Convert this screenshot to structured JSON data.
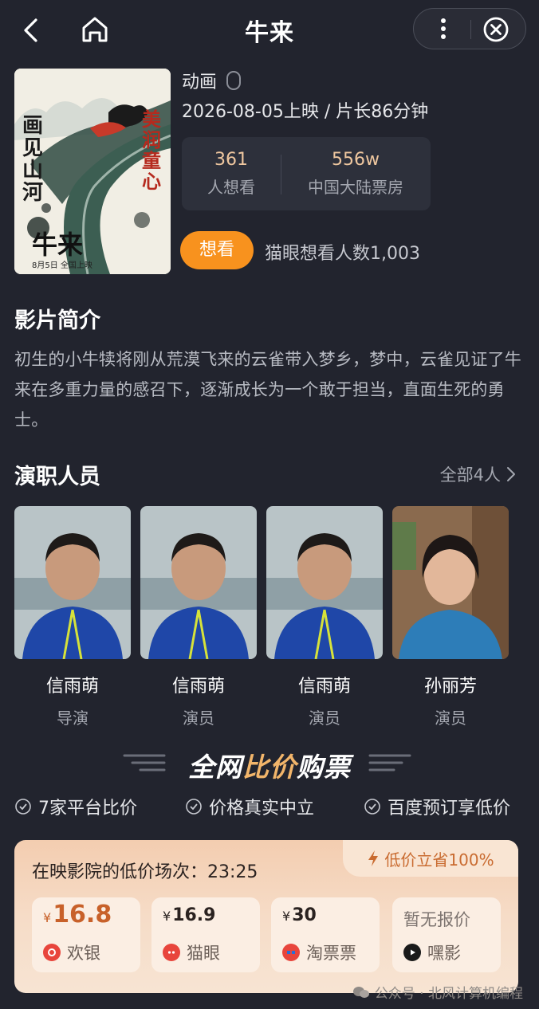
{
  "header": {
    "title": "牛来"
  },
  "poster": {
    "vertical_left": [
      "画",
      "见",
      "山",
      "河"
    ],
    "vertical_right": [
      "美",
      "润",
      "童",
      "心"
    ],
    "bottom_title": "牛来",
    "bottom_date": "8月5日  全国上映"
  },
  "movie": {
    "genre": "动画",
    "release": "2026-08-05上映 / 片长86分钟",
    "stats": [
      {
        "value": "361",
        "label": "人想看"
      },
      {
        "value": "556w",
        "label": "中国大陆票房"
      }
    ],
    "want_label": "想看",
    "maoyan_want": "猫眼想看人数1,003"
  },
  "synopsis": {
    "title": "影片简介",
    "text": "初生的小牛犊将刚从荒漠飞来的云雀带入梦乡，梦中，云雀见证了牛来在多重力量的感召下，逐渐成长为一个敢于担当，直面生死的勇士。"
  },
  "cast": {
    "title": "演职人员",
    "all_label": "全部4人",
    "members": [
      {
        "name": "信雨萌",
        "role": "导演"
      },
      {
        "name": "信雨萌",
        "role": "演员"
      },
      {
        "name": "信雨萌",
        "role": "演员"
      },
      {
        "name": "孙丽芳",
        "role": "演员"
      }
    ]
  },
  "compare": {
    "title_a": "全网",
    "title_b": "比价",
    "title_c": "购票",
    "features": [
      "7家平台比价",
      "价格真实中立",
      "百度预订享低价"
    ],
    "head": "在映影院的低价场次：23:25",
    "save_tag": "低价立省100%",
    "platforms": [
      {
        "price": "16.8",
        "yen": "¥",
        "name": "欢银",
        "logo_color": "#e8453c"
      },
      {
        "price": "16.9",
        "yen": "¥",
        "name": "猫眼",
        "logo_color": "#e8453c"
      },
      {
        "price": "30",
        "yen": "¥",
        "name": "淘票票",
        "logo_color": "#e8453c"
      },
      {
        "price": "暂无报价",
        "yen": "",
        "name": "嘿影",
        "logo_color": "#1a1a1a"
      }
    ]
  },
  "watermark": "公众号 · 北风计算机编程",
  "colors": {
    "background": "#22242e",
    "accent": "#f8921e",
    "stat": "#f0c8a0",
    "card": "#f3cdb0"
  }
}
